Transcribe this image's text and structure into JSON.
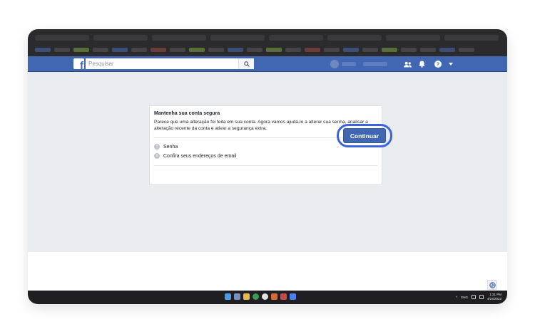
{
  "facebook": {
    "logo_letter": "f",
    "search_placeholder": "Pesquisar",
    "icons": [
      "friends-icon",
      "notifications-icon",
      "help-icon",
      "dropdown-icon"
    ],
    "brand_color": "#4267b2"
  },
  "card": {
    "title": "Mantenha sua conta segura",
    "description": "Parece que uma alteração foi feita em sua conta. Agora vamos ajudá-lo a alterar sua senha, analisar a alteração recente da conta e ativar a segurança extra.",
    "steps": [
      {
        "number": "1",
        "label": "Senha"
      },
      {
        "number": "2",
        "label": "Confira seus endereços de email"
      }
    ],
    "continue_label": "Continuar"
  },
  "highlight_color": "#3d63e3",
  "taskbar": {
    "tray_lang": "ENG",
    "time": "1:31 PM",
    "date": "4/24/2023"
  }
}
